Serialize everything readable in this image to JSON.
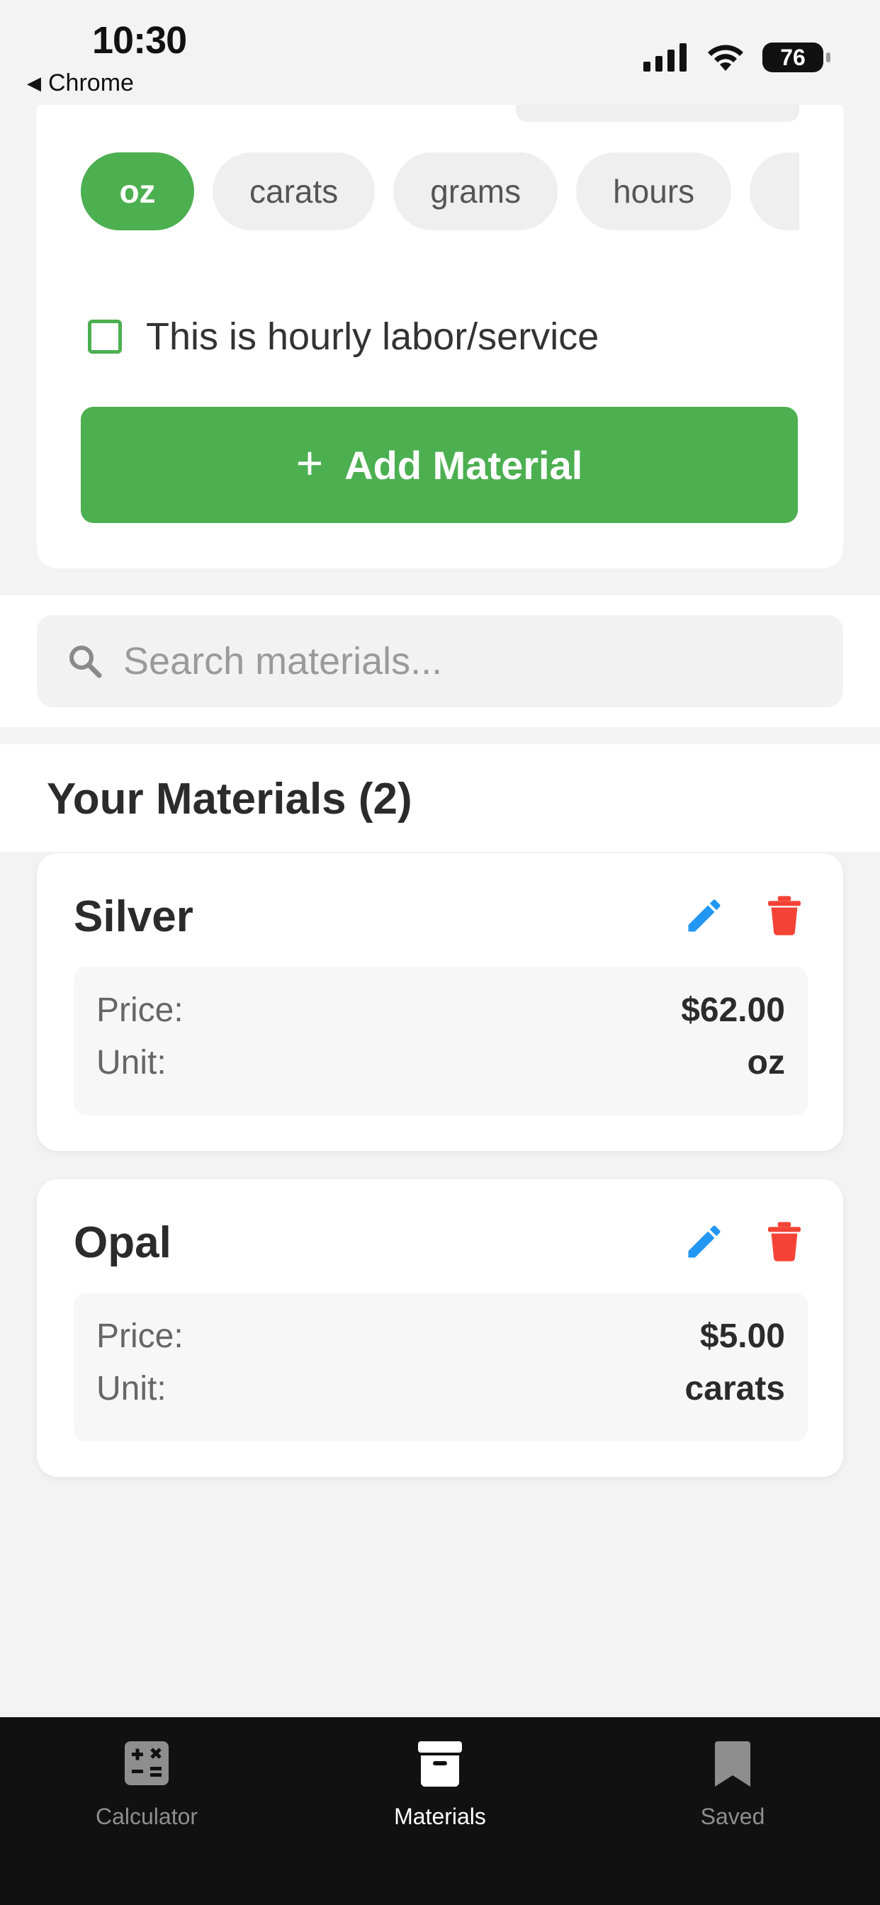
{
  "status_bar": {
    "time": "10:30",
    "back_app": "Chrome",
    "battery": "76"
  },
  "unit_chips": [
    "oz",
    "carats",
    "grams",
    "hours"
  ],
  "selected_unit": "oz",
  "hourly_checkbox": {
    "label": "This is hourly labor/service",
    "checked": false
  },
  "add_button": {
    "icon": "plus-icon",
    "label": "Add Material"
  },
  "search": {
    "placeholder": "Search materials...",
    "icon": "search-icon"
  },
  "materials_section": {
    "title": "Your Materials (2)"
  },
  "materials": [
    {
      "name": "Silver",
      "price_label": "Price:",
      "price": "$62.00",
      "unit_label": "Unit:",
      "unit": "oz"
    },
    {
      "name": "Opal",
      "price_label": "Price:",
      "price": "$5.00",
      "unit_label": "Unit:",
      "unit": "carats"
    }
  ],
  "tab_bar": {
    "tabs": [
      {
        "label": "Calculator",
        "icon": "calculator-icon",
        "active": false
      },
      {
        "label": "Materials",
        "icon": "archive-box-icon",
        "active": true
      },
      {
        "label": "Saved",
        "icon": "bookmark-icon",
        "active": false
      }
    ]
  },
  "colors": {
    "accent_green": "#4caf50",
    "edit_blue": "#2196f3",
    "delete_red": "#f44336",
    "tab_bar_bg": "#111111"
  }
}
